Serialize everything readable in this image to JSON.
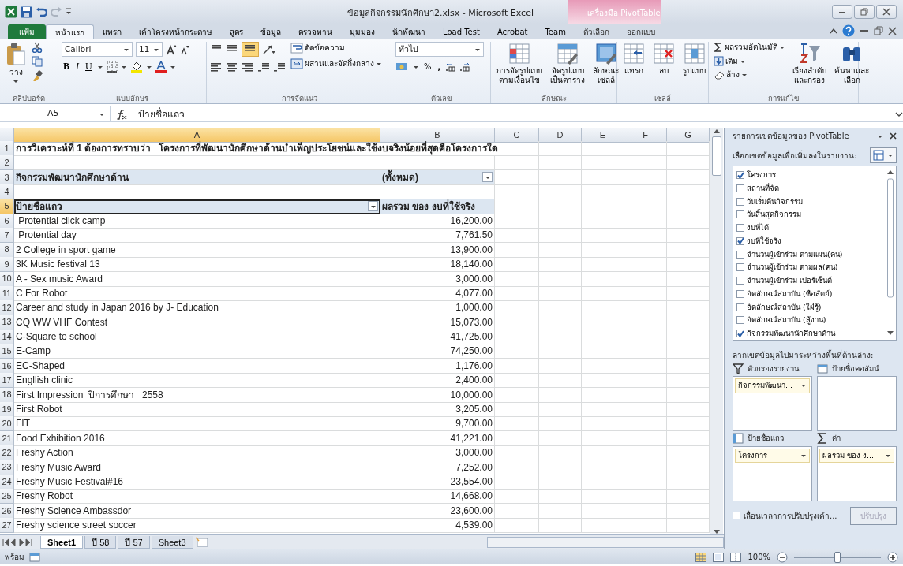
{
  "window": {
    "title": "ข้อมูลกิจกรรมนักศึกษา2.xlsx - Microsoft Excel",
    "context_group": "เครื่องมือ PivotTable"
  },
  "ribbon_tabs": [
    {
      "label": "แฟ้ม",
      "kind": "file",
      "selected": false
    },
    {
      "label": "หน้าแรก",
      "kind": "normal",
      "selected": true
    },
    {
      "label": "แทรก",
      "kind": "normal",
      "selected": false
    },
    {
      "label": "เค้าโครงหน้ากระดาษ",
      "kind": "normal",
      "selected": false
    },
    {
      "label": "สูตร",
      "kind": "normal",
      "selected": false
    },
    {
      "label": "ข้อมูล",
      "kind": "normal",
      "selected": false
    },
    {
      "label": "ตรวจทาน",
      "kind": "normal",
      "selected": false
    },
    {
      "label": "มุมมอง",
      "kind": "normal",
      "selected": false
    },
    {
      "label": "นักพัฒนา",
      "kind": "normal",
      "selected": false
    },
    {
      "label": "Load Test",
      "kind": "normal",
      "selected": false
    },
    {
      "label": "Acrobat",
      "kind": "normal",
      "selected": false
    },
    {
      "label": "Team",
      "kind": "normal",
      "selected": false
    },
    {
      "label": "ตัวเลือก",
      "kind": "context",
      "selected": false
    },
    {
      "label": "ออกแบบ",
      "kind": "context",
      "selected": false
    }
  ],
  "ribbon": {
    "clipboard": {
      "label": "คลิปบอร์ด",
      "paste": "วาง"
    },
    "font": {
      "label": "แบบอักษร",
      "font_name": "Calibri",
      "font_size": "11",
      "bold": "B",
      "italic": "I",
      "underline": "U"
    },
    "alignment": {
      "label": "การจัดแนว",
      "wrap_text": "ตัดข้อความ",
      "merge_center": "ผสานและจัดกึ่งกลาง"
    },
    "number": {
      "label": "ตัวเลข",
      "format": "ทั่วไป",
      "percent": "%",
      "comma": ","
    },
    "styles": {
      "label": "ลักษณะ",
      "conditional_formatting": [
        "การจัดรูปแบบ",
        "ตามเงื่อนไข"
      ],
      "format_as_table": [
        "จัดรูปแบบ",
        "เป็นตาราง"
      ],
      "cell_styles": [
        "ลักษณะ",
        "เซลล์"
      ]
    },
    "cells": {
      "label": "เซลล์",
      "insert": "แทรก",
      "delete": "ลบ",
      "format": "รูปแบบ"
    },
    "editing": {
      "label": "การแก้ไข",
      "autosum": "ผลรวมอัตโนมัติ",
      "fill": "เติม",
      "clear": "ล้าง",
      "sort_filter": [
        "เรียงลำดับ",
        "และกรอง"
      ],
      "find_select": [
        "ค้นหาและ",
        "เลือก"
      ]
    }
  },
  "formula_bar": {
    "name_box": "A5",
    "formula": "ป้ายชื่อแถว"
  },
  "sheet": {
    "columns": [
      {
        "label": "A",
        "selected": true
      },
      {
        "label": "B",
        "selected": false
      },
      {
        "label": "C",
        "selected": false
      },
      {
        "label": "D",
        "selected": false
      },
      {
        "label": "E",
        "selected": false
      },
      {
        "label": "F",
        "selected": false
      },
      {
        "label": "G",
        "selected": false
      }
    ],
    "rows": [
      {
        "number": "1",
        "kind": "title",
        "selected": false,
        "a": "การวิเคราะห์ที่ 1 ต้องการทราบว่า   โครงการที่พัฒนานักศึกษาด้านบำเพ็ญประโยชน์และใช้งบจริงน้อยที่สุดคือโครงการใด"
      },
      {
        "number": "2",
        "kind": "blank",
        "selected": false
      },
      {
        "number": "3",
        "kind": "filter",
        "selected": false,
        "a": "กิจกรรมพัฒนานักศึกษาด้าน",
        "b": "(ทั้งหมด)"
      },
      {
        "number": "4",
        "kind": "blank",
        "selected": false
      },
      {
        "number": "5",
        "kind": "header",
        "selected": true,
        "a": "ป้ายชื่อแถว",
        "b": "ผลรวม ของ งบที่ใช้จริง"
      },
      {
        "number": "6",
        "kind": "data",
        "selected": false,
        "a": " Protential click camp",
        "b": "16,200.00"
      },
      {
        "number": "7",
        "kind": "data",
        "selected": false,
        "a": " Protential day",
        "b": "7,761.50"
      },
      {
        "number": "8",
        "kind": "data",
        "selected": false,
        "a": "2 College in sport game",
        "b": "13,900.00"
      },
      {
        "number": "9",
        "kind": "data",
        "selected": false,
        "a": "3K Music festival 13",
        "b": "18,140.00"
      },
      {
        "number": "10",
        "kind": "data",
        "selected": false,
        "a": "A - Sex music Award",
        "b": "3,000.00"
      },
      {
        "number": "11",
        "kind": "data",
        "selected": false,
        "a": "C For Robot",
        "b": "4,077.00"
      },
      {
        "number": "12",
        "kind": "data",
        "selected": false,
        "a": "Career and study in Japan 2016 by J- Education",
        "b": "1,000.00"
      },
      {
        "number": "13",
        "kind": "data",
        "selected": false,
        "a": "CQ WW VHF Contest",
        "b": "15,073.00"
      },
      {
        "number": "14",
        "kind": "data",
        "selected": false,
        "a": "C-Square to school",
        "b": "41,725.00"
      },
      {
        "number": "15",
        "kind": "data",
        "selected": false,
        "a": "E-Camp",
        "b": "74,250.00"
      },
      {
        "number": "16",
        "kind": "data",
        "selected": false,
        "a": "EC-Shaped",
        "b": "1,176.00"
      },
      {
        "number": "17",
        "kind": "data",
        "selected": false,
        "a": "Engllish clinic",
        "b": "2,400.00"
      },
      {
        "number": "18",
        "kind": "data",
        "selected": false,
        "a": "First Impression  ปีการศึกษา   2558",
        "b": "10,000.00"
      },
      {
        "number": "19",
        "kind": "data",
        "selected": false,
        "a": "First Robot",
        "b": "3,205.00"
      },
      {
        "number": "20",
        "kind": "data",
        "selected": false,
        "a": "FIT",
        "b": "9,700.00"
      },
      {
        "number": "21",
        "kind": "data",
        "selected": false,
        "a": "Food Exhibition 2016",
        "b": "41,221.00"
      },
      {
        "number": "22",
        "kind": "data",
        "selected": false,
        "a": "Freshy Action",
        "b": "3,000.00"
      },
      {
        "number": "23",
        "kind": "data",
        "selected": false,
        "a": "Freshy Music Award",
        "b": "7,252.00"
      },
      {
        "number": "24",
        "kind": "data",
        "selected": false,
        "a": "Freshy Music Festival#16",
        "b": "23,554.00"
      },
      {
        "number": "25",
        "kind": "data",
        "selected": false,
        "a": "Freshy Robot",
        "b": "14,668.00"
      },
      {
        "number": "26",
        "kind": "data",
        "selected": false,
        "a": "Freshy Science Ambassdor",
        "b": "23,600.00"
      },
      {
        "number": "27",
        "kind": "data",
        "selected": false,
        "a": "Freshy science street soccer",
        "b": "4,539.00"
      }
    ]
  },
  "sheet_tabs": [
    {
      "label": "Sheet1",
      "selected": true
    },
    {
      "label": "ปี 58",
      "selected": false
    },
    {
      "label": "ปี 57",
      "selected": false
    },
    {
      "label": "Sheet3",
      "selected": false
    }
  ],
  "pivot_pane": {
    "title": "รายการเขตข้อมูลของ PivotTable",
    "choose_label": "เลือกเขตข้อมูลเพื่อเพิ่มลงในรายงาน:",
    "fields": [
      {
        "label": "โครงการ",
        "checked": true
      },
      {
        "label": "สถานที่จัด",
        "checked": false
      },
      {
        "label": "วันเริ่มต้นกิจกรรม",
        "checked": false
      },
      {
        "label": "วันสิ้นสุดกิจกรรม",
        "checked": false
      },
      {
        "label": "งบที่ได้",
        "checked": false
      },
      {
        "label": "งบที่ใช้จริง",
        "checked": true
      },
      {
        "label": "จำนวนผู้เข้าร่วม ตามแผน(คน)",
        "checked": false
      },
      {
        "label": "จำนวนผู้เข้าร่วม ตามผล(คน)",
        "checked": false
      },
      {
        "label": "จำนวนผู้เข้าร่วม เปอร์เซ็นต์",
        "checked": false
      },
      {
        "label": "อัตลักษณ์สถาบัน (ซื่อสัตย์)",
        "checked": false
      },
      {
        "label": "อัตลักษณ์สถาบัน (ใฝ่รู้)",
        "checked": false
      },
      {
        "label": "อัตลักษณ์สถาบัน (สู้งาน)",
        "checked": false
      },
      {
        "label": "กิจกรรมพัฒนานักศึกษาด้าน",
        "checked": true
      }
    ],
    "drag_label": "ลากเขตข้อมูลไปมาระหว่างพื้นที่ด้านล่าง:",
    "areas": [
      {
        "kind": "filter",
        "label": "ตัวกรองรายงาน",
        "items": [
          "กิจกรรมพัฒนา..."
        ]
      },
      {
        "kind": "columns",
        "label": "ป้ายชื่อคอลัมน์"
      },
      {
        "kind": "rows",
        "label": "ป้ายชื่อแถว",
        "items": [
          "โครงการ"
        ]
      },
      {
        "kind": "values",
        "label": "ค่า",
        "items": [
          "ผลรวม ของ ง..."
        ]
      }
    ],
    "defer": {
      "label": "เลื่อนเวลาการปรับปรุงเค้า...",
      "checked": false
    },
    "update_button": {
      "label": "ปรับปรุง",
      "disabled": true
    }
  },
  "status_bar": {
    "ready": "พร้อม",
    "zoom": "100%",
    "zoom_slider": {
      "level": 0.5
    }
  }
}
